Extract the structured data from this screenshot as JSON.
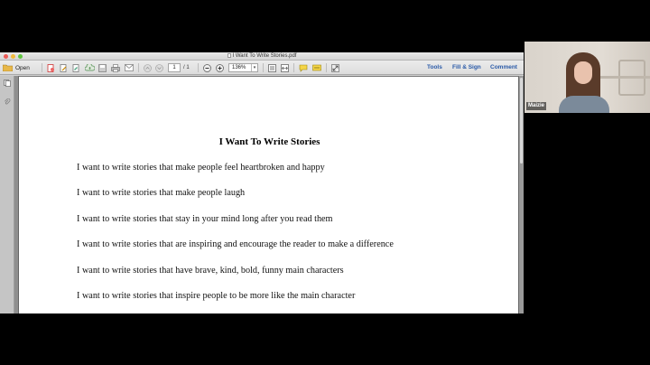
{
  "window": {
    "title": "I Want To Write Stories.pdf"
  },
  "toolbar": {
    "open_label": "Open",
    "page_current": "1",
    "page_total": "/ 1",
    "zoom": "136%",
    "tools_label": "Tools",
    "fill_sign_label": "Fill & Sign",
    "comment_label": "Comment"
  },
  "document": {
    "title": "I Want To Write Stories",
    "lines": [
      "I want to write stories that make people feel heartbroken and happy",
      "I want to write stories that make people laugh",
      "I want to write stories that stay in your mind long after you read them",
      "I want to write stories that are inspiring and encourage the reader to make a difference",
      "I want to write stories that have brave, kind, bold, funny main characters",
      "I want to write stories that inspire people to be more like the main character"
    ]
  },
  "webcam": {
    "participant_name": "Maizie"
  },
  "colors": {
    "link_blue": "#2a5aa8",
    "close": "#ec5b57",
    "minimize": "#f2bb3c",
    "maximize": "#5fc53f"
  }
}
